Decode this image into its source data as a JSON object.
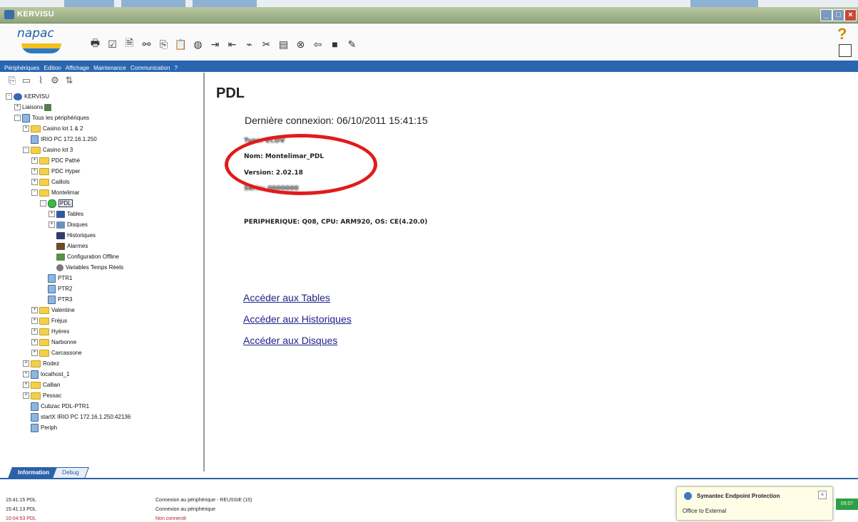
{
  "window": {
    "title": "KERVISU"
  },
  "logo": {
    "text": "napac"
  },
  "toolbar_icons": [
    "printer-icon",
    "checkbox-icon",
    "document-icon",
    "binoculars-icon",
    "copy-icon",
    "paste-icon",
    "globe-icon",
    "export-icon",
    "import-icon",
    "plug-icon",
    "unplug-icon",
    "properties-icon",
    "stop-icon",
    "back-icon",
    "black-square-icon",
    "tools-icon"
  ],
  "menu": [
    "Périphériques",
    "Edition",
    "Affichage",
    "Maintenance",
    "Communication",
    "?"
  ],
  "tree": [
    {
      "label": "KERVISU",
      "level": 0,
      "expander": "-",
      "icon": "globe"
    },
    {
      "label": "Liaisons",
      "level": 1,
      "expander": "+",
      "icon": "link"
    },
    {
      "label": "Tous les périphériques",
      "level": 1,
      "expander": "-",
      "icon": "dev"
    },
    {
      "label": "Casino lot 1 & 2",
      "level": 2,
      "expander": "+",
      "icon": "folder"
    },
    {
      "label": "IRIO PC 172.16.1.250",
      "level": 2,
      "expander": "",
      "icon": "dev"
    },
    {
      "label": "Casino lot 3",
      "level": 2,
      "expander": "-",
      "icon": "folder"
    },
    {
      "label": "PDC Pathé",
      "level": 3,
      "expander": "+",
      "icon": "folder"
    },
    {
      "label": "PDC Hyper",
      "level": 3,
      "expander": "+",
      "icon": "folder"
    },
    {
      "label": "Caillols",
      "level": 3,
      "expander": "+",
      "icon": "folder"
    },
    {
      "label": "Montelimar",
      "level": 3,
      "expander": "-",
      "icon": "folder"
    },
    {
      "label": "PDL",
      "level": 4,
      "expander": "-",
      "icon": "green",
      "selected": true
    },
    {
      "label": "Tables",
      "level": 5,
      "expander": "+",
      "icon": "tbl"
    },
    {
      "label": "Disques",
      "level": 5,
      "expander": "+",
      "icon": "disk"
    },
    {
      "label": "Historiques",
      "level": 5,
      "expander": "",
      "icon": "hist"
    },
    {
      "label": "Alarmes",
      "level": 5,
      "expander": "",
      "icon": "alarm"
    },
    {
      "label": "Configuration Offline",
      "level": 5,
      "expander": "",
      "icon": "cfg"
    },
    {
      "label": "Variables Temps Réels",
      "level": 5,
      "expander": "",
      "icon": "var"
    },
    {
      "label": "PTR1",
      "level": 4,
      "expander": "",
      "icon": "dev"
    },
    {
      "label": "PTR2",
      "level": 4,
      "expander": "",
      "icon": "dev"
    },
    {
      "label": "PTR3",
      "level": 4,
      "expander": "",
      "icon": "dev"
    },
    {
      "label": "Valentine",
      "level": 3,
      "expander": "+",
      "icon": "folder"
    },
    {
      "label": "Fréjus",
      "level": 3,
      "expander": "+",
      "icon": "folder"
    },
    {
      "label": "Hyères",
      "level": 3,
      "expander": "+",
      "icon": "folder"
    },
    {
      "label": "Narbonne",
      "level": 3,
      "expander": "+",
      "icon": "folder"
    },
    {
      "label": "Carcassone",
      "level": 3,
      "expander": "+",
      "icon": "folder"
    },
    {
      "label": "Rodez",
      "level": 2,
      "expander": "+",
      "icon": "folder"
    },
    {
      "label": "localhost_1",
      "level": 2,
      "expander": "+",
      "icon": "dev"
    },
    {
      "label": "Callian",
      "level": 2,
      "expander": "+",
      "icon": "folder"
    },
    {
      "label": "Pessac",
      "level": 2,
      "expander": "+",
      "icon": "folder"
    },
    {
      "label": "Cubzac PDL-PTR1",
      "level": 2,
      "expander": "",
      "icon": "dev"
    },
    {
      "label": "startX IRIO PC 172.16.1.250:42136",
      "level": 2,
      "expander": "",
      "icon": "dev"
    },
    {
      "label": "Periph",
      "level": 2,
      "expander": "",
      "icon": "dev"
    }
  ],
  "tabs": {
    "information": "Information",
    "debug": "Debug"
  },
  "main": {
    "title": "PDL",
    "last_connection": "Dernière connexion: 06/10/2011 15:41:15",
    "type_line": "Type: ECDV",
    "name_line": "Nom: Montelimar_PDL",
    "version_line": "Version: 2.02.18",
    "serie_line": "Série: 0000000",
    "peripheral_line": "PERIPHERIQUE: Q08, CPU: ARM920, OS: CE(4.20.0)",
    "links": [
      "Accéder aux Tables",
      "Accéder aux Historiques",
      "Accéder aux Disques"
    ]
  },
  "log": [
    {
      "time": "15:41:15 PDL",
      "message": "Connexion au périphérique - REUSSIE (15)",
      "error": false
    },
    {
      "time": "15:41:13 PDL",
      "message": "Connexion au périphérique",
      "error": false
    },
    {
      "time": "10:04:53 PDL",
      "message": "Non connecté",
      "error": true
    }
  ],
  "notification": {
    "title": "Symantec Endpoint Protection",
    "body": "Office to External"
  },
  "clock": "09:07"
}
